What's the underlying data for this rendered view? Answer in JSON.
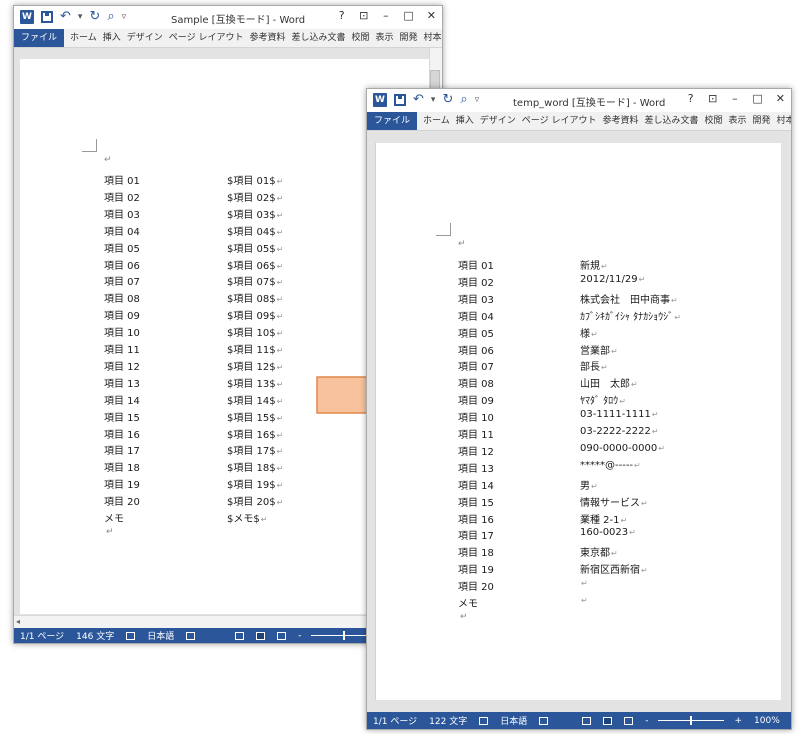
{
  "ribbon_tabs": [
    "ホーム",
    "挿入",
    "デザイン",
    "ページ レイアウト",
    "参考資料",
    "差し込み文書",
    "校閲",
    "表示",
    "開発"
  ],
  "file_tab": "ファイル",
  "user_name": "村本俊和",
  "window_controls": {
    "help": "?",
    "ribbon_options": "⊡",
    "minimize": "–",
    "maximize": "□",
    "close": "✕"
  },
  "template_window": {
    "title": "Sample [互換モード] - Word",
    "rows": [
      {
        "label": "項目 01",
        "value": "$項目 01$"
      },
      {
        "label": "項目 02",
        "value": "$項目 02$"
      },
      {
        "label": "項目 03",
        "value": "$項目 03$"
      },
      {
        "label": "項目 04",
        "value": "$項目 04$"
      },
      {
        "label": "項目 05",
        "value": "$項目 05$"
      },
      {
        "label": "項目 06",
        "value": "$項目 06$"
      },
      {
        "label": "項目 07",
        "value": "$項目 07$"
      },
      {
        "label": "項目 08",
        "value": "$項目 08$"
      },
      {
        "label": "項目 09",
        "value": "$項目 09$"
      },
      {
        "label": "項目 10",
        "value": "$項目 10$"
      },
      {
        "label": "項目 11",
        "value": "$項目 11$"
      },
      {
        "label": "項目 12",
        "value": "$項目 12$"
      },
      {
        "label": "項目 13",
        "value": "$項目 13$"
      },
      {
        "label": "項目 14",
        "value": "$項目 14$"
      },
      {
        "label": "項目 15",
        "value": "$項目 15$"
      },
      {
        "label": "項目 16",
        "value": "$項目 16$"
      },
      {
        "label": "項目 17",
        "value": "$項目 17$"
      },
      {
        "label": "項目 18",
        "value": "$項目 18$"
      },
      {
        "label": "項目 19",
        "value": "$項目 19$"
      },
      {
        "label": "項目 20",
        "value": "$項目 20$"
      },
      {
        "label": "メモ",
        "value": "$メモ$"
      }
    ],
    "status": {
      "page": "1/1 ページ",
      "words": "146 文字",
      "language": "日本語"
    }
  },
  "result_window": {
    "title": "temp_word [互換モード] - Word",
    "rows": [
      {
        "label": "項目 01",
        "value": "新規"
      },
      {
        "label": "項目 02",
        "value": "2012/11/29"
      },
      {
        "label": "項目 03",
        "value": "株式会社　田中商事"
      },
      {
        "label": "項目 04",
        "value": "ｶﾌﾞｼｷｶﾞｲｼｬ ﾀﾅｶｼｮｳｼﾞ"
      },
      {
        "label": "項目 05",
        "value": "様"
      },
      {
        "label": "項目 06",
        "value": "営業部"
      },
      {
        "label": "項目 07",
        "value": "部長"
      },
      {
        "label": "項目 08",
        "value": "山田　太郎"
      },
      {
        "label": "項目 09",
        "value": "ﾔﾏﾀﾞ ﾀﾛｳ"
      },
      {
        "label": "項目 10",
        "value": "03-1111-1111"
      },
      {
        "label": "項目 11",
        "value": "03-2222-2222"
      },
      {
        "label": "項目 12",
        "value": "090-0000-0000"
      },
      {
        "label": "項目 13",
        "value": "*****@-----"
      },
      {
        "label": "項目 14",
        "value": "男"
      },
      {
        "label": "項目 15",
        "value": "情報サービス"
      },
      {
        "label": "項目 16",
        "value": "業種 2-1"
      },
      {
        "label": "項目 17",
        "value": "160-0023"
      },
      {
        "label": "項目 18",
        "value": "東京都"
      },
      {
        "label": "項目 19",
        "value": "新宿区西新宿"
      },
      {
        "label": "項目 20",
        "value": ""
      },
      {
        "label": "メモ",
        "value": ""
      }
    ],
    "status": {
      "page": "1/1 ページ",
      "words": "122 文字",
      "language": "日本語",
      "zoom_minus": "-",
      "zoom_plus": "+",
      "zoom": "100%"
    }
  },
  "colors": {
    "accent": "#2b579a",
    "arrow_fill": "#f8c39c",
    "arrow_stroke": "#e0884a"
  }
}
